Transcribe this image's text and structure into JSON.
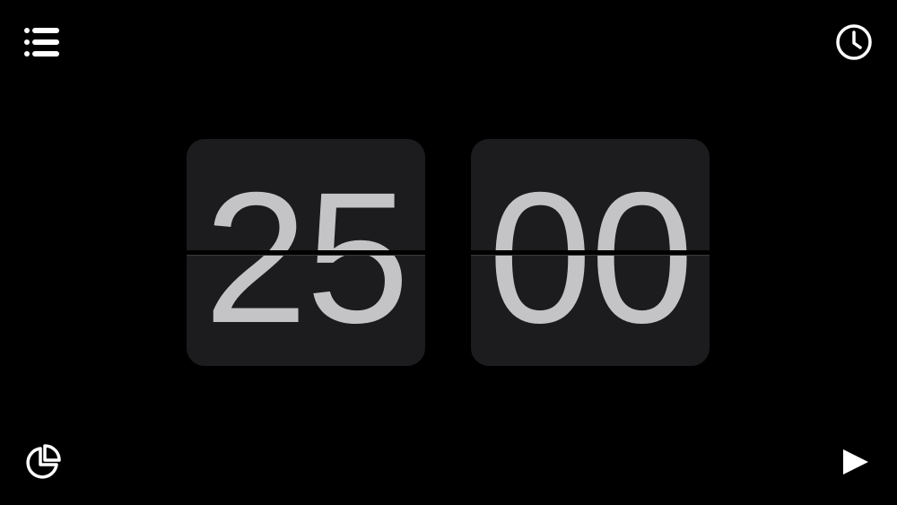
{
  "timer": {
    "minutes": "25",
    "seconds": "00"
  },
  "controls": {
    "menu_icon": "list-icon",
    "clock_icon": "clock-icon",
    "stats_icon": "pie-chart-icon",
    "play_icon": "play-icon"
  },
  "colors": {
    "background": "#000000",
    "card": "#1c1c1e",
    "digit": "#c4c4c6",
    "icon": "#ffffff"
  }
}
